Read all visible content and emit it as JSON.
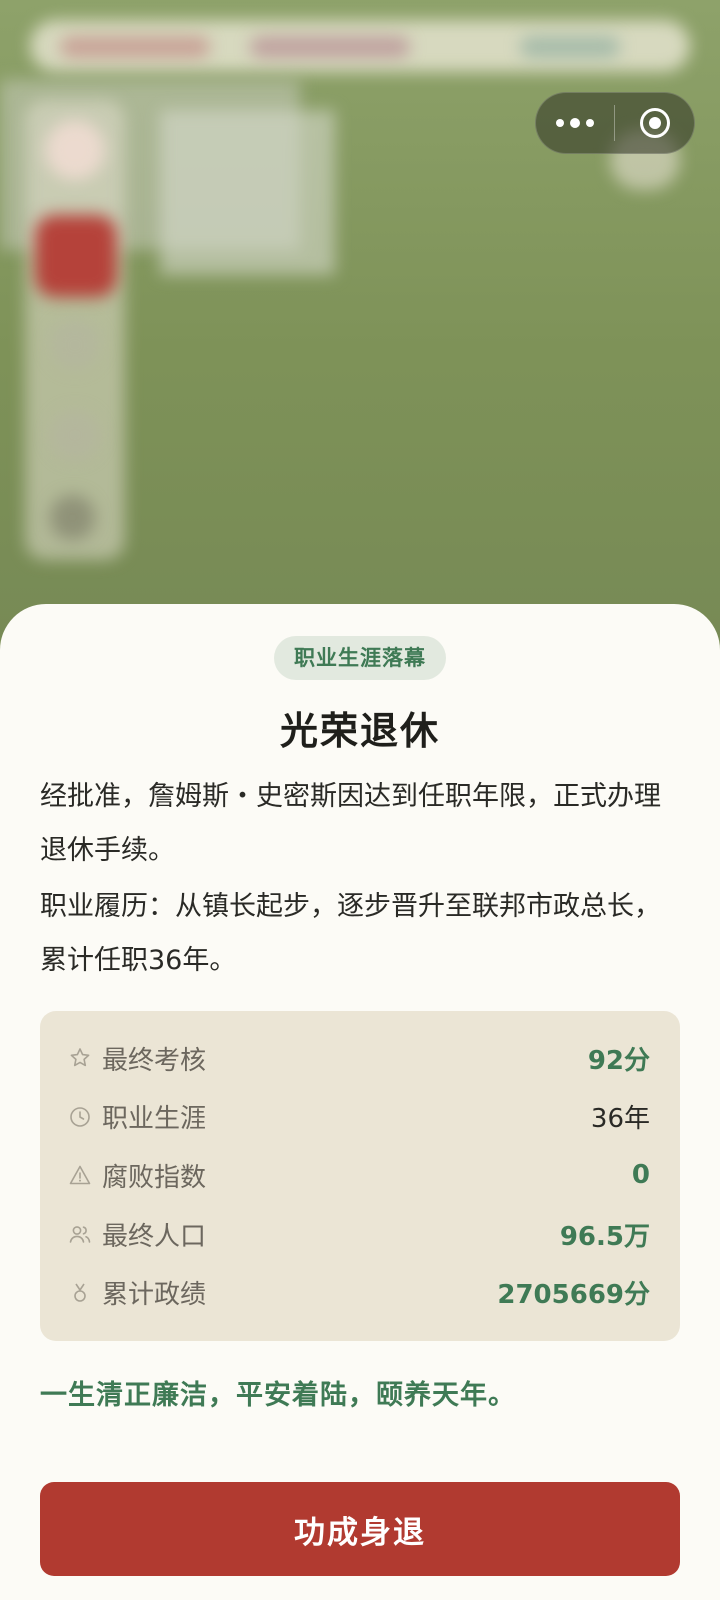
{
  "sheet": {
    "badge": "职业生涯落幕",
    "title": "光荣退休",
    "paragraph1": "经批准，詹姆斯・史密斯因达到任职年限，正式办理退休手续。",
    "paragraph2": "职业履历：从镇长起步，逐步晋升至联邦市政总长，累计任职36年。",
    "stats": [
      {
        "icon": "star-icon",
        "label": "最终考核",
        "value": "92分"
      },
      {
        "icon": "clock-icon",
        "label": "职业生涯",
        "value": "36年"
      },
      {
        "icon": "warning-icon",
        "label": "腐败指数",
        "value": "0"
      },
      {
        "icon": "users-icon",
        "label": "最终人口",
        "value": "96.5万"
      },
      {
        "icon": "medal-icon",
        "label": "累计政绩",
        "value": "2705669分"
      }
    ],
    "motto": "一生清正廉洁，平安着陆，颐养天年。",
    "button_label": "功成身退"
  },
  "capsule": {
    "more_icon": "more-dots-icon",
    "close_icon": "close-circle-icon"
  },
  "colors": {
    "accent_green": "#3f7a55",
    "button_red": "#b13a30",
    "sheet_bg": "#fcfbf6",
    "stats_bg": "#ebe5d5"
  }
}
